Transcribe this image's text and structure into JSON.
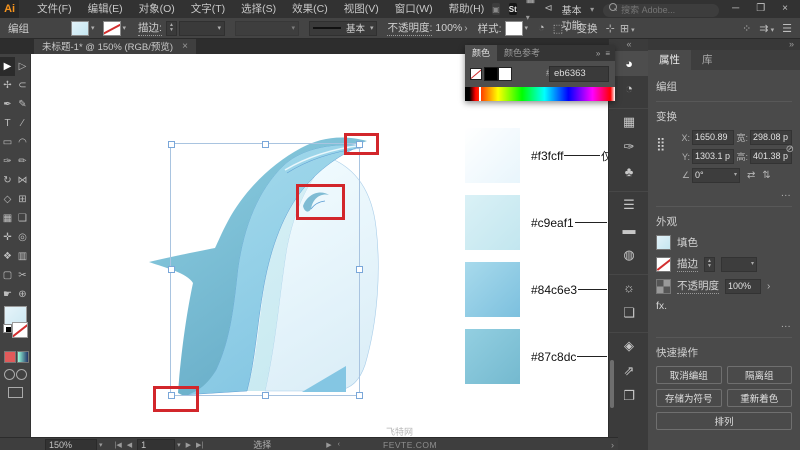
{
  "menu_bar": {
    "logo": "Ai",
    "items": [
      "文件(F)",
      "编辑(E)",
      "对象(O)",
      "文字(T)",
      "选择(S)",
      "效果(C)",
      "视图(V)",
      "窗口(W)",
      "帮助(H)"
    ],
    "stock_badge": "St",
    "workspace": "传统基本功能",
    "search_placeholder": "搜索 Adobe...",
    "window_controls": {
      "minimize": "─",
      "restore": "❐",
      "close": "×"
    }
  },
  "control_bar": {
    "context_label": "编组",
    "stroke_label": "描边:",
    "brush_profile": "基本",
    "opacity_label": "不透明度:",
    "opacity_value": "100%",
    "style_label": "样式:",
    "transform_label": "变换"
  },
  "document_tab": {
    "title": "未标题-1* @ 150% (RGB/预览)",
    "close": "×"
  },
  "toolbar": {
    "tools": [
      {
        "l": "▶",
        "r": "▷",
        "active": "l"
      },
      {
        "l": "✢",
        "r": "⊂"
      },
      {
        "l": "✒",
        "r": "✎"
      },
      {
        "l": "T",
        "r": "∕"
      },
      {
        "l": "▭",
        "r": "◠"
      },
      {
        "l": "✑",
        "r": "✏"
      },
      {
        "l": "↻",
        "r": "⋈"
      },
      {
        "l": "◇",
        "r": "⊞"
      },
      {
        "l": "▦",
        "r": "❑"
      },
      {
        "l": "✛",
        "r": "◎"
      },
      {
        "l": "❖",
        "r": "▥"
      },
      {
        "l": "▢",
        "r": "✂"
      },
      {
        "l": "☛",
        "r": "⊕"
      }
    ]
  },
  "canvas": {
    "swatches": [
      {
        "hex": "#f3fcff",
        "from": "#ffffff",
        "to": "#e8f5fc",
        "clipped": "仅"
      },
      {
        "hex": "#c9eaf1",
        "from": "#daf1f6",
        "to": "#c2e6ef"
      },
      {
        "hex": "#84c6e3",
        "from": "#a8daec",
        "to": "#7cc0de"
      },
      {
        "hex": "#87c8dc",
        "from": "#93cfe1",
        "to": "#74b9cf"
      }
    ],
    "watermark": "飞特网"
  },
  "color_panel": {
    "tabs": {
      "active": "颜色",
      "inactive": "颜色参考"
    },
    "hex_label": "#",
    "hex_value": "eb6363"
  },
  "properties": {
    "tabs": {
      "active": "属性",
      "inactive": "库"
    },
    "selection_type": "编组",
    "transform": {
      "title": "变换",
      "x_label": "X:",
      "x_value": "1650.89",
      "y_label": "Y:",
      "y_value": "1303.1 p",
      "w_label": "宽:",
      "w_value": "298.08 p",
      "h_label": "高:",
      "h_value": "401.38 p",
      "angle_value": "0°"
    },
    "appearance": {
      "title": "外观",
      "fill_label": "填色",
      "stroke_label": "描边",
      "opacity_label": "不透明度",
      "opacity_value": "100%",
      "fx_label": "fx."
    },
    "quick_actions": {
      "title": "快速操作",
      "buttons": [
        "取消编组",
        "隔离组",
        "存储为符号",
        "重新着色",
        "排列"
      ]
    }
  },
  "status_bar": {
    "zoom": "150%",
    "artboard_nav": {
      "first": "|◀",
      "prev": "◀",
      "current": "1",
      "next": "▶",
      "last": "▶|"
    },
    "tool_name": "选择",
    "site_watermark": "FEVTE.COM",
    "chevron": "›"
  }
}
